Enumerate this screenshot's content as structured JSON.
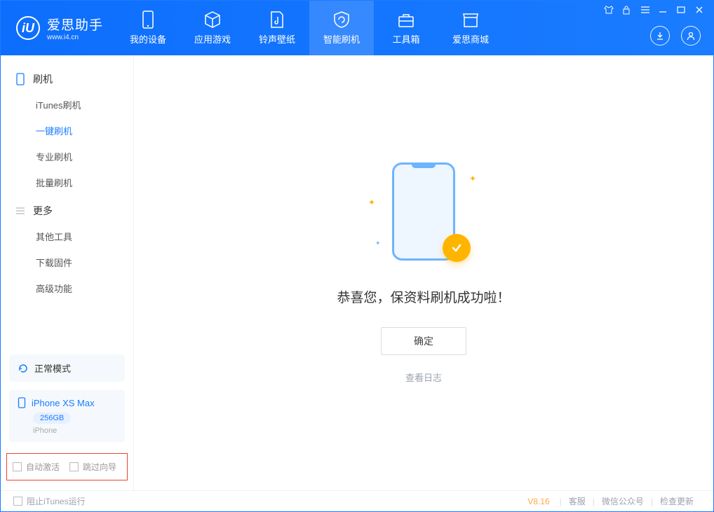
{
  "app": {
    "name": "爱思助手",
    "site": "www.i4.cn"
  },
  "nav": {
    "tabs": [
      {
        "label": "我的设备"
      },
      {
        "label": "应用游戏"
      },
      {
        "label": "铃声壁纸"
      },
      {
        "label": "智能刷机"
      },
      {
        "label": "工具箱"
      },
      {
        "label": "爱思商城"
      }
    ],
    "active_index": 3
  },
  "sidebar": {
    "section1": {
      "title": "刷机",
      "items": [
        {
          "label": "iTunes刷机"
        },
        {
          "label": "一键刷机"
        },
        {
          "label": "专业刷机"
        },
        {
          "label": "批量刷机"
        }
      ],
      "active_index": 1
    },
    "section2": {
      "title": "更多",
      "items": [
        {
          "label": "其他工具"
        },
        {
          "label": "下载固件"
        },
        {
          "label": "高级功能"
        }
      ]
    },
    "mode": {
      "label": "正常模式"
    },
    "device": {
      "name": "iPhone XS Max",
      "capacity": "256GB",
      "type": "iPhone"
    },
    "checks": {
      "auto_activate": "自动激活",
      "skip_guide": "跳过向导"
    }
  },
  "main": {
    "success_text": "恭喜您，保资料刷机成功啦！",
    "ok_button": "确定",
    "view_log": "查看日志"
  },
  "footer": {
    "block_itunes": "阻止iTunes运行",
    "version": "V8.16",
    "links": {
      "service": "客服",
      "wechat": "微信公众号",
      "update": "检查更新"
    }
  }
}
